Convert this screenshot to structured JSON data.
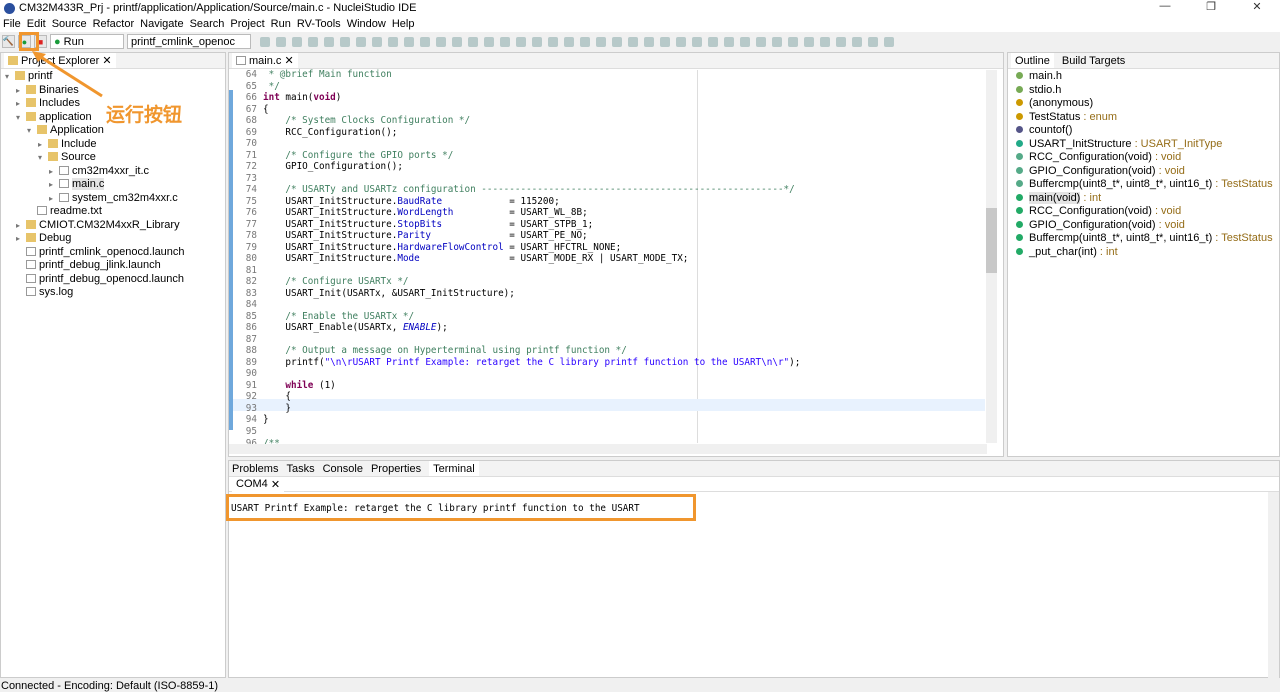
{
  "window": {
    "title": "CM32M433R_Prj - printf/application/Application/Source/main.c - NucleiStudio IDE",
    "min": "—",
    "max": "❐",
    "close": "✕"
  },
  "menu": [
    "File",
    "Edit",
    "Source",
    "Refactor",
    "Navigate",
    "Search",
    "Project",
    "Run",
    "RV-Tools",
    "Window",
    "Help"
  ],
  "toolbar": {
    "run_mode": "Run",
    "launch_config": "printf_cmlink_openoc"
  },
  "annotation": {
    "label": "运行按钮"
  },
  "explorer": {
    "title": "Project Explorer",
    "items": [
      {
        "label": "printf",
        "depth": 0,
        "arrow": "⌄",
        "icon": "folder"
      },
      {
        "label": "Binaries",
        "depth": 1,
        "arrow": "›",
        "icon": "folder"
      },
      {
        "label": "Includes",
        "depth": 1,
        "arrow": "›",
        "icon": "folder"
      },
      {
        "label": "application",
        "depth": 1,
        "arrow": "⌄",
        "icon": "folder"
      },
      {
        "label": "Application",
        "depth": 2,
        "arrow": "⌄",
        "icon": "folder"
      },
      {
        "label": "Include",
        "depth": 3,
        "arrow": "›",
        "icon": "folder"
      },
      {
        "label": "Source",
        "depth": 3,
        "arrow": "⌄",
        "icon": "folder"
      },
      {
        "label": "cm32m4xxr_it.c",
        "depth": 4,
        "arrow": "›",
        "icon": "file"
      },
      {
        "label": "main.c",
        "depth": 4,
        "arrow": "›",
        "icon": "file",
        "selected": true
      },
      {
        "label": "system_cm32m4xxr.c",
        "depth": 4,
        "arrow": "›",
        "icon": "file"
      },
      {
        "label": "readme.txt",
        "depth": 2,
        "arrow": "",
        "icon": "file"
      },
      {
        "label": "CMIOT.CM32M4xxR_Library",
        "depth": 1,
        "arrow": "›",
        "icon": "folder"
      },
      {
        "label": "Debug",
        "depth": 1,
        "arrow": "›",
        "icon": "folder"
      },
      {
        "label": "printf_cmlink_openocd.launch",
        "depth": 1,
        "arrow": "",
        "icon": "file"
      },
      {
        "label": "printf_debug_jlink.launch",
        "depth": 1,
        "arrow": "",
        "icon": "file"
      },
      {
        "label": "printf_debug_openocd.launch",
        "depth": 1,
        "arrow": "",
        "icon": "file"
      },
      {
        "label": "sys.log",
        "depth": 1,
        "arrow": "",
        "icon": "file"
      }
    ]
  },
  "editor": {
    "tab": "main.c",
    "lines": [
      {
        "n": "64",
        "seg": [
          [
            " * @brief Main function",
            "c"
          ]
        ]
      },
      {
        "n": "65",
        "seg": [
          [
            " */",
            "c"
          ]
        ]
      },
      {
        "n": "66",
        "seg": [
          [
            "int ",
            "k"
          ],
          [
            "main(",
            "n"
          ],
          [
            "void",
            "k"
          ],
          [
            ")",
            "n"
          ]
        ]
      },
      {
        "n": "67",
        "seg": [
          [
            "{",
            "n"
          ]
        ]
      },
      {
        "n": "68",
        "seg": [
          [
            "    /* System Clocks Configuration */",
            "c"
          ]
        ]
      },
      {
        "n": "69",
        "seg": [
          [
            "    RCC_Configuration();",
            "n"
          ]
        ]
      },
      {
        "n": "70",
        "seg": []
      },
      {
        "n": "71",
        "seg": [
          [
            "    /* Configure the GPIO ports */",
            "c"
          ]
        ]
      },
      {
        "n": "72",
        "seg": [
          [
            "    GPIO_Configuration();",
            "n"
          ]
        ]
      },
      {
        "n": "73",
        "seg": []
      },
      {
        "n": "74",
        "seg": [
          [
            "    /* USARTy and USARTz configuration ------------------------------------------------------*/",
            "c"
          ]
        ]
      },
      {
        "n": "75",
        "seg": [
          [
            "    USART_InitStructure.",
            "n"
          ],
          [
            "BaudRate",
            "f"
          ],
          [
            "            = 115200;",
            "n"
          ]
        ]
      },
      {
        "n": "76",
        "seg": [
          [
            "    USART_InitStructure.",
            "n"
          ],
          [
            "WordLength",
            "f"
          ],
          [
            "          = USART_WL_8B;",
            "n"
          ]
        ]
      },
      {
        "n": "77",
        "seg": [
          [
            "    USART_InitStructure.",
            "n"
          ],
          [
            "StopBits",
            "f"
          ],
          [
            "            = USART_STPB_1;",
            "n"
          ]
        ]
      },
      {
        "n": "78",
        "seg": [
          [
            "    USART_InitStructure.",
            "n"
          ],
          [
            "Parity",
            "f"
          ],
          [
            "              = USART_PE_NO;",
            "n"
          ]
        ]
      },
      {
        "n": "79",
        "seg": [
          [
            "    USART_InitStructure.",
            "n"
          ],
          [
            "HardwareFlowControl",
            "f"
          ],
          [
            " = USART_HFCTRL_NONE;",
            "n"
          ]
        ]
      },
      {
        "n": "80",
        "seg": [
          [
            "    USART_InitStructure.",
            "n"
          ],
          [
            "Mode",
            "f"
          ],
          [
            "                = USART_MODE_RX | USART_MODE_TX;",
            "n"
          ]
        ]
      },
      {
        "n": "81",
        "seg": []
      },
      {
        "n": "82",
        "seg": [
          [
            "    /* Configure USARTx */",
            "c"
          ]
        ]
      },
      {
        "n": "83",
        "seg": [
          [
            "    USART_Init(USARTx, &USART_InitStructure);",
            "n"
          ]
        ]
      },
      {
        "n": "84",
        "seg": []
      },
      {
        "n": "85",
        "seg": [
          [
            "    /* Enable the USARTx */",
            "c"
          ]
        ]
      },
      {
        "n": "86",
        "seg": [
          [
            "    USART_Enable(USARTx, ",
            "n"
          ],
          [
            "ENABLE",
            "i"
          ],
          [
            ");",
            "n"
          ]
        ]
      },
      {
        "n": "87",
        "seg": []
      },
      {
        "n": "88",
        "seg": [
          [
            "    /* Output a message on Hyperterminal using printf function */",
            "c"
          ]
        ]
      },
      {
        "n": "89",
        "seg": [
          [
            "    printf(",
            "n"
          ],
          [
            "\"\\n\\rUSART Printf Example: retarget the C library printf function to the USART\\n\\r\"",
            "s"
          ],
          [
            ");",
            "n"
          ]
        ]
      },
      {
        "n": "90",
        "seg": []
      },
      {
        "n": "91",
        "seg": [
          [
            "    ",
            "n"
          ],
          [
            "while",
            "k"
          ],
          [
            " (1)",
            "n"
          ]
        ]
      },
      {
        "n": "92",
        "seg": [
          [
            "    {",
            "n"
          ]
        ]
      },
      {
        "n": "93",
        "seg": [
          [
            "    }",
            "n"
          ]
        ]
      },
      {
        "n": "94",
        "seg": [
          [
            "}",
            "n"
          ]
        ]
      },
      {
        "n": "95",
        "seg": []
      },
      {
        "n": "96",
        "seg": [
          [
            "/**",
            "c"
          ]
        ]
      }
    ]
  },
  "outline": {
    "tabs": [
      "Outline",
      "Build Targets"
    ],
    "items": [
      {
        "name": "main.h",
        "type": "",
        "icon": "include"
      },
      {
        "name": "stdio.h",
        "type": "",
        "icon": "include"
      },
      {
        "name": "(anonymous)",
        "type": "",
        "icon": "enum",
        "arrow": "›"
      },
      {
        "name": "TestStatus",
        "type": " : enum",
        "icon": "typedef"
      },
      {
        "name": "countof()",
        "type": "",
        "icon": "macro"
      },
      {
        "name": "USART_InitStructure",
        "type": " : USART_InitType",
        "icon": "var"
      },
      {
        "name": "RCC_Configuration(void)",
        "type": " : void",
        "icon": "decl"
      },
      {
        "name": "GPIO_Configuration(void)",
        "type": " : void",
        "icon": "decl"
      },
      {
        "name": "Buffercmp(uint8_t*, uint8_t*, uint16_t)",
        "type": " : TestStatus",
        "icon": "decl"
      },
      {
        "name": "main(void)",
        "type": " : int",
        "icon": "func",
        "selected": true
      },
      {
        "name": "RCC_Configuration(void)",
        "type": " : void",
        "icon": "func"
      },
      {
        "name": "GPIO_Configuration(void)",
        "type": " : void",
        "icon": "func"
      },
      {
        "name": "Buffercmp(uint8_t*, uint8_t*, uint16_t)",
        "type": " : TestStatus",
        "icon": "func"
      },
      {
        "name": "_put_char(int)",
        "type": " : int",
        "icon": "func"
      }
    ]
  },
  "bottom": {
    "tabs": [
      "Problems",
      "Tasks",
      "Console",
      "Properties",
      "Terminal"
    ],
    "active": "Terminal",
    "terminal_tab": "COM4",
    "output": "USART Printf Example: retarget the C library printf function to the USART"
  },
  "status": {
    "text": "Connected - Encoding: Default (ISO-8859-1)"
  },
  "colors": {
    "accent": "#f0962e",
    "selection": "#e4e4e4"
  }
}
